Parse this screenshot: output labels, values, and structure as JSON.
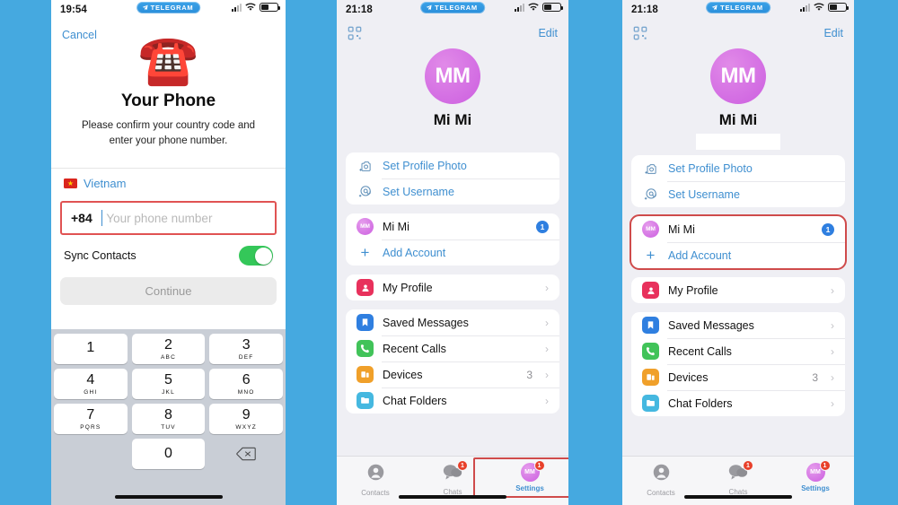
{
  "background_color": "#45a9e0",
  "accent_color": "#3f8fd0",
  "highlight_color": "#cf4b4b",
  "phone1": {
    "status": {
      "time": "19:54",
      "badge": "TELEGRAM",
      "badge_icon": "paper-plane-icon"
    },
    "cancel_label": "Cancel",
    "hero_icon": "telephone-emoji",
    "title": "Your Phone",
    "subtitle": "Please confirm your country code and enter your phone number.",
    "country": {
      "flag_icon": "vietnam-flag-icon",
      "name": "Vietnam"
    },
    "phone_field": {
      "country_code": "+84",
      "value": "",
      "placeholder": "Your phone number"
    },
    "sync_contacts": {
      "label": "Sync Contacts",
      "enabled": "on"
    },
    "continue_label": "Continue",
    "keypad": [
      {
        "num": "1",
        "alpha": ""
      },
      {
        "num": "2",
        "alpha": "ABC"
      },
      {
        "num": "3",
        "alpha": "DEF"
      },
      {
        "num": "4",
        "alpha": "GHI"
      },
      {
        "num": "5",
        "alpha": "JKL"
      },
      {
        "num": "6",
        "alpha": "MNO"
      },
      {
        "num": "7",
        "alpha": "PQRS"
      },
      {
        "num": "8",
        "alpha": "TUV"
      },
      {
        "num": "9",
        "alpha": "WXYZ"
      },
      {
        "num": "0",
        "alpha": ""
      }
    ],
    "delete_icon": "backspace-icon"
  },
  "phone2": {
    "status": {
      "time": "21:18",
      "badge": "TELEGRAM",
      "badge_icon": "paper-plane-icon"
    },
    "nav": {
      "qr_icon": "qr-code-icon",
      "edit_label": "Edit"
    },
    "profile": {
      "initials": "MM",
      "name": "Mi Mi",
      "redacted": false
    },
    "group_actions": [
      {
        "icon": "add-photo-icon",
        "label": "Set Profile Photo"
      },
      {
        "icon": "at-sign-icon",
        "label": "Set Username"
      }
    ],
    "group_accounts": {
      "highlighted": false,
      "rows": [
        {
          "icon": "account-avatar",
          "initials": "MM",
          "label": "Mi Mi",
          "badge": "1"
        },
        {
          "icon": "plus-icon",
          "label": "Add Account"
        }
      ]
    },
    "group_profile": [
      {
        "icon": "person-icon",
        "color": "#e8315c",
        "label": "My Profile",
        "chevron": "›"
      }
    ],
    "group_settings": [
      {
        "icon": "bookmark-icon",
        "color": "#2f7fe0",
        "label": "Saved Messages",
        "value": "",
        "chevron": "›"
      },
      {
        "icon": "phone-icon",
        "color": "#41c359",
        "label": "Recent Calls",
        "value": "",
        "chevron": "›"
      },
      {
        "icon": "devices-icon",
        "color": "#f0a02a",
        "label": "Devices",
        "value": "3",
        "chevron": "›"
      },
      {
        "icon": "folder-icon",
        "color": "#45b8e0",
        "label": "Chat Folders",
        "value": "",
        "chevron": "›"
      }
    ],
    "tabs": [
      {
        "icon": "contacts-icon",
        "label": "Contacts",
        "badge": "",
        "active": false,
        "highlighted": false
      },
      {
        "icon": "chats-icon",
        "label": "Chats",
        "badge": "1",
        "active": false,
        "highlighted": false
      },
      {
        "icon": "settings-avatar-icon",
        "label": "Settings",
        "badge": "1",
        "active": true,
        "highlighted": true
      }
    ]
  },
  "phone3": {
    "status": {
      "time": "21:18",
      "badge": "TELEGRAM",
      "badge_icon": "paper-plane-icon"
    },
    "nav": {
      "qr_icon": "qr-code-icon",
      "edit_label": "Edit"
    },
    "profile": {
      "initials": "MM",
      "name": "Mi Mi",
      "redacted": true
    },
    "group_actions": [
      {
        "icon": "add-photo-icon",
        "label": "Set Profile Photo"
      },
      {
        "icon": "at-sign-icon",
        "label": "Set Username"
      }
    ],
    "group_accounts": {
      "highlighted": true,
      "rows": [
        {
          "icon": "account-avatar",
          "initials": "MM",
          "label": "Mi Mi",
          "badge": "1"
        },
        {
          "icon": "plus-icon",
          "label": "Add Account"
        }
      ]
    },
    "group_profile": [
      {
        "icon": "person-icon",
        "color": "#e8315c",
        "label": "My Profile",
        "chevron": "›"
      }
    ],
    "group_settings": [
      {
        "icon": "bookmark-icon",
        "color": "#2f7fe0",
        "label": "Saved Messages",
        "value": "",
        "chevron": "›"
      },
      {
        "icon": "phone-icon",
        "color": "#41c359",
        "label": "Recent Calls",
        "value": "",
        "chevron": "›"
      },
      {
        "icon": "devices-icon",
        "color": "#f0a02a",
        "label": "Devices",
        "value": "3",
        "chevron": "›"
      },
      {
        "icon": "folder-icon",
        "color": "#45b8e0",
        "label": "Chat Folders",
        "value": "",
        "chevron": "›"
      }
    ],
    "tabs": [
      {
        "icon": "contacts-icon",
        "label": "Contacts",
        "badge": "",
        "active": false,
        "highlighted": false
      },
      {
        "icon": "chats-icon",
        "label": "Chats",
        "badge": "1",
        "active": false,
        "highlighted": false
      },
      {
        "icon": "settings-avatar-icon",
        "label": "Settings",
        "badge": "1",
        "active": true,
        "highlighted": false
      }
    ]
  }
}
